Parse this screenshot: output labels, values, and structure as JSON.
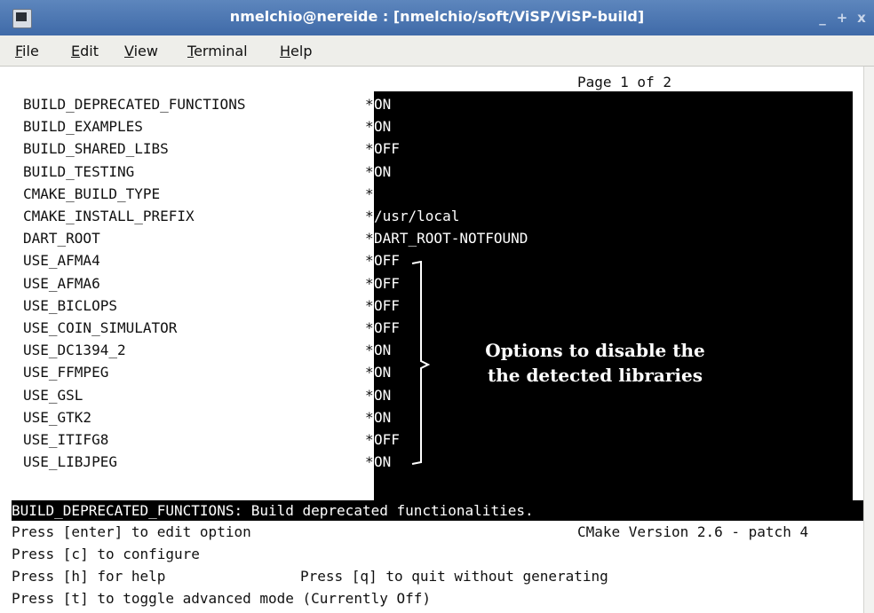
{
  "window": {
    "title": "nmelchio@nereide : [nmelchio/soft/ViSP/ViSP-build]",
    "buttons": [
      "_",
      "+",
      "x"
    ]
  },
  "menu": [
    {
      "u": "F",
      "rest": "ile"
    },
    {
      "u": "E",
      "rest": "dit"
    },
    {
      "u": "V",
      "rest": "iew"
    },
    {
      "u": "T",
      "rest": "erminal"
    },
    {
      "u": "H",
      "rest": "elp"
    }
  ],
  "page_indicator": "Page 1 of 2",
  "options": [
    {
      "name": "BUILD_DEPRECATED_FUNCTIONS",
      "star": "*",
      "value": "ON"
    },
    {
      "name": "BUILD_EXAMPLES",
      "star": "*",
      "value": "ON"
    },
    {
      "name": "BUILD_SHARED_LIBS",
      "star": "*",
      "value": "OFF"
    },
    {
      "name": "BUILD_TESTING",
      "star": "*",
      "value": "ON"
    },
    {
      "name": "CMAKE_BUILD_TYPE",
      "star": "*",
      "value": ""
    },
    {
      "name": "CMAKE_INSTALL_PREFIX",
      "star": "*",
      "value": "/usr/local"
    },
    {
      "name": "DART_ROOT",
      "star": "*",
      "value": "DART_ROOT-NOTFOUND"
    },
    {
      "name": "USE_AFMA4",
      "star": "*",
      "value": "OFF"
    },
    {
      "name": "USE_AFMA6",
      "star": "*",
      "value": "OFF"
    },
    {
      "name": "USE_BICLOPS",
      "star": "*",
      "value": "OFF"
    },
    {
      "name": "USE_COIN_SIMULATOR",
      "star": "*",
      "value": "OFF"
    },
    {
      "name": "USE_DC1394_2",
      "star": "*",
      "value": "ON"
    },
    {
      "name": "USE_FFMPEG",
      "star": "*",
      "value": "ON"
    },
    {
      "name": "USE_GSL",
      "star": "*",
      "value": "ON"
    },
    {
      "name": "USE_GTK2",
      "star": "*",
      "value": "ON"
    },
    {
      "name": "USE_ITIFG8",
      "star": "*",
      "value": "OFF"
    },
    {
      "name": "USE_LIBJPEG",
      "star": "*",
      "value": "ON"
    }
  ],
  "annotation": {
    "line1": "Options to disable the",
    "line2": "the detected libraries"
  },
  "status": "BUILD_DEPRECATED_FUNCTIONS: Build deprecated functionalities.",
  "help": {
    "enter": "Press [enter] to edit option",
    "version": "CMake Version 2.6 - patch 4",
    "configure": "Press [c] to configure",
    "help": "Press [h] for help",
    "quit": "Press [q] to quit without generating",
    "toggle": "Press [t] to toggle advanced mode (Currently Off)"
  }
}
